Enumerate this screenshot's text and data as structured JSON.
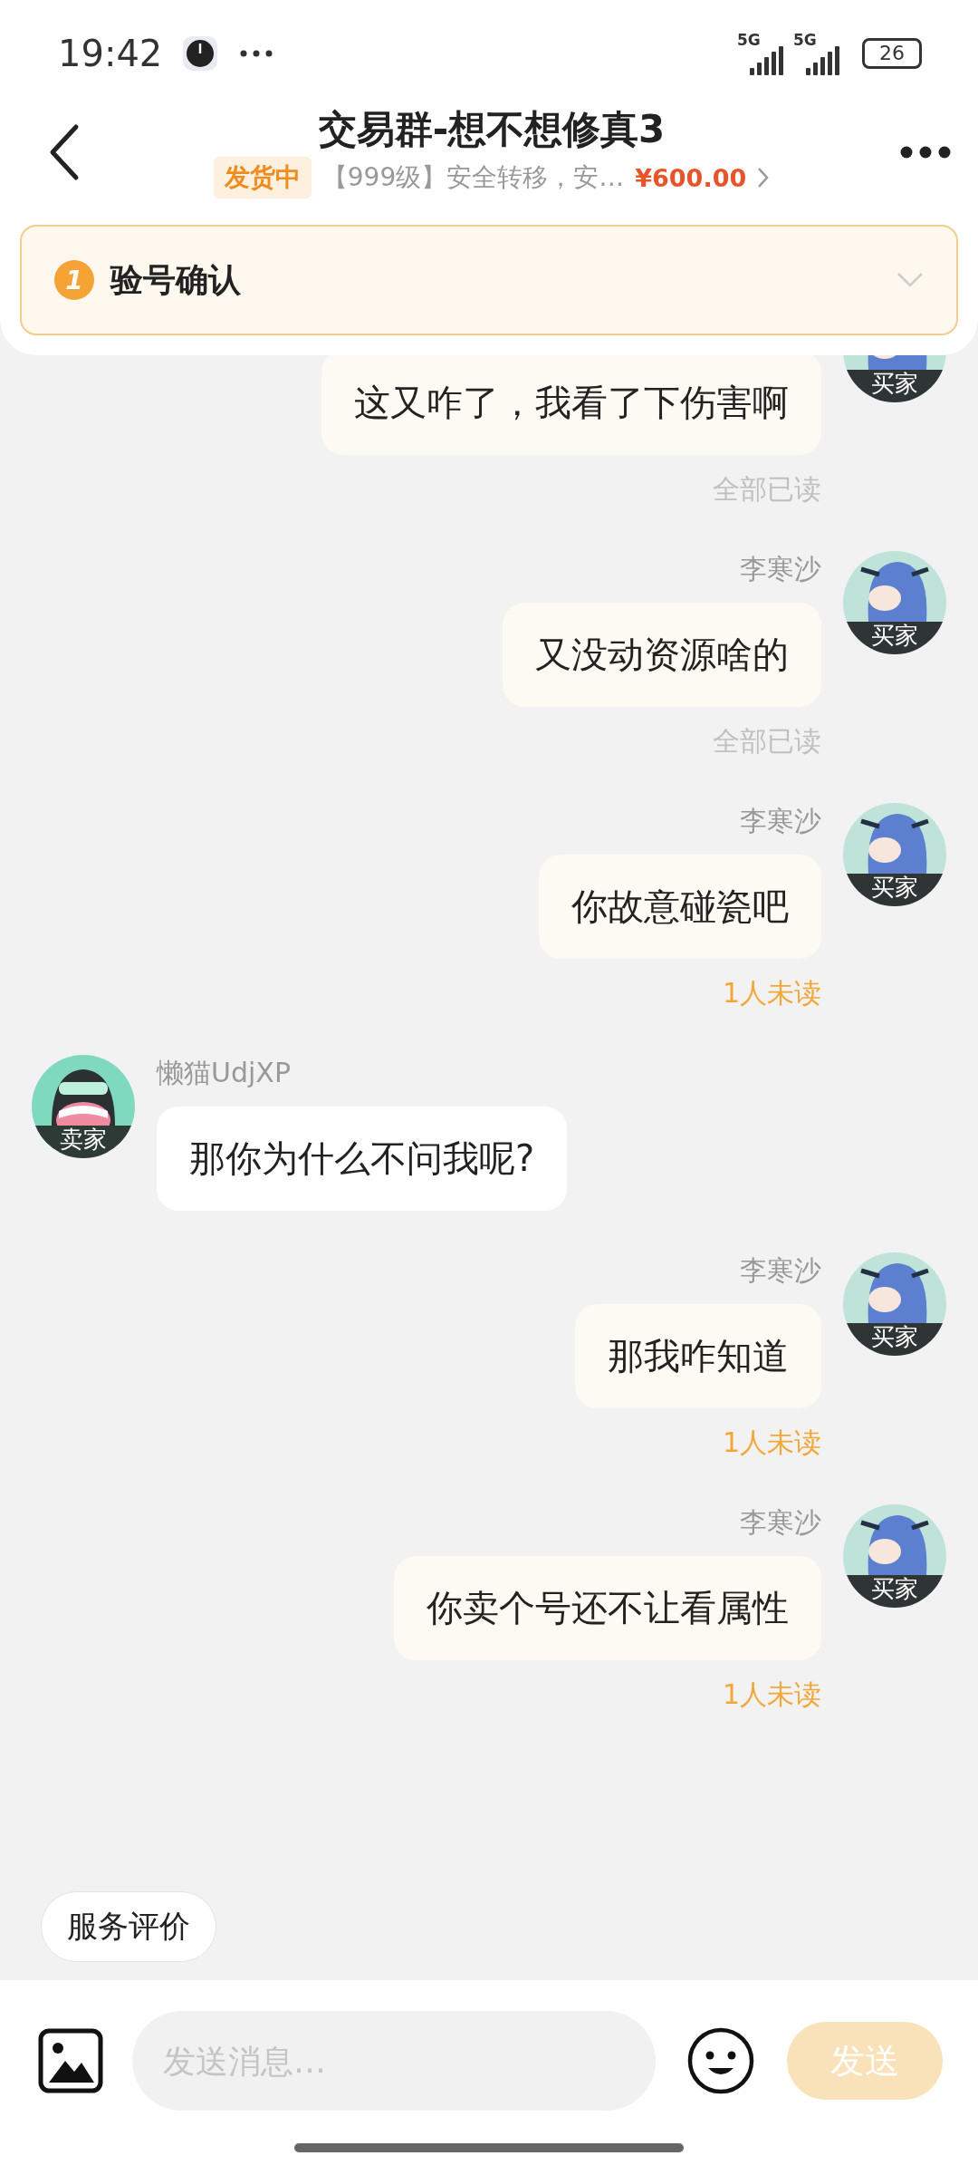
{
  "status_bar": {
    "time": "19:42",
    "networks": [
      "5G",
      "5G"
    ],
    "battery": "26"
  },
  "header": {
    "title": "交易群-想不想修真3",
    "status_badge": "发货中",
    "item_title": "【999级】安全转移，安…",
    "price": "¥600.00"
  },
  "banner": {
    "step": "1",
    "label": "验号确认",
    "expanded": false
  },
  "messages": [
    {
      "kind": "outgoing",
      "role": "买家",
      "text": "这又咋了，我看了下伤害啊",
      "receipt": {
        "text": "全部已读",
        "all_read": true
      }
    },
    {
      "kind": "outgoing",
      "name": "李寒沙",
      "role": "买家",
      "text": "又没动资源啥的",
      "receipt": {
        "text": "全部已读",
        "all_read": true
      }
    },
    {
      "kind": "outgoing",
      "name": "李寒沙",
      "role": "买家",
      "text": "你故意碰瓷吧",
      "receipt": {
        "text": "1人未读",
        "all_read": false
      }
    },
    {
      "kind": "incoming",
      "name": "懒猫UdjXP",
      "role": "卖家",
      "text": "那你为什么不问我呢?"
    },
    {
      "kind": "outgoing",
      "name": "李寒沙",
      "role": "买家",
      "text": "那我咋知道",
      "receipt": {
        "text": "1人未读",
        "all_read": false
      }
    },
    {
      "kind": "outgoing",
      "name": "李寒沙",
      "role": "买家",
      "text": "你卖个号还不让看属性",
      "receipt": {
        "text": "1人未读",
        "all_read": false
      }
    }
  ],
  "quick_action": "服务评价",
  "composer": {
    "placeholder": "发送消息…",
    "send_label": "发送",
    "send_disabled": true
  }
}
